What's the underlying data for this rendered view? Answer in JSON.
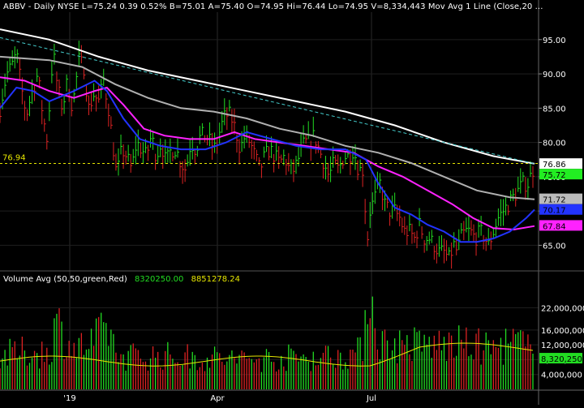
{
  "header": {
    "text": "ABBV - Daily  NYSE  L=75.24  0.39  0.52%  B=75.01  A=75.40  O=74.95  Hi=76.44  Lo=74.95  V=8,334,443  Mov Avg 1 Line (Close,20 ..."
  },
  "volume_header": {
    "label": "Volume Avg (50,50,green,Red)",
    "value1": "8320250.00",
    "value2": "8851278.24"
  },
  "colors": {
    "background": "#000000",
    "up_candle": "#22dd22",
    "down_candle": "#dd2222",
    "ma_white": "#ffffff",
    "ma_gray": "#b0b0b0",
    "ma_magenta": "#ff22ff",
    "ma_blue": "#2233ff",
    "trendline": "#44cccc",
    "ref_line": "#e6e600",
    "volume_avg": "#e6e600"
  },
  "chart_data": [
    {
      "type": "candlestick",
      "title": "ABBV - Daily NYSE",
      "x_labels": [
        "'19",
        "Apr",
        "Jul"
      ],
      "y_ticks": [
        "95.00",
        "90.00",
        "85.00",
        "80.00",
        "75.00",
        "70.00",
        "65.00"
      ],
      "ylim": [
        61.5,
        99
      ],
      "reference_line": {
        "value": 76.94,
        "label": "76.94"
      },
      "price_labels": [
        {
          "label": "76.86",
          "value": 76.86,
          "bg": "#ffffff",
          "fg": "#000000"
        },
        {
          "label": "75.72",
          "value": 75.72,
          "bg": "#22ee22",
          "fg": "#000000"
        },
        {
          "label": "71.72",
          "value": 71.72,
          "bg": "#bbbbbb",
          "fg": "#000000"
        },
        {
          "label": "70.17",
          "value": 70.17,
          "bg": "#2233ff",
          "fg": "#000000"
        },
        {
          "label": "67.84",
          "value": 67.84,
          "bg": "#ff22ff",
          "fg": "#000000"
        }
      ],
      "price_anchors": [
        [
          0,
          85
        ],
        [
          8,
          90
        ],
        [
          14,
          91
        ],
        [
          20,
          93
        ],
        [
          26,
          88
        ],
        [
          32,
          84
        ],
        [
          38,
          87
        ],
        [
          46,
          90
        ],
        [
          52,
          84
        ],
        [
          58,
          80
        ],
        [
          62,
          90
        ],
        [
          66,
          92
        ],
        [
          70,
          88
        ],
        [
          76,
          85
        ],
        [
          82,
          89
        ],
        [
          88,
          85
        ],
        [
          96,
          92
        ],
        [
          102,
          91
        ],
        [
          108,
          85
        ],
        [
          114,
          87
        ],
        [
          120,
          86
        ],
        [
          126,
          89
        ],
        [
          132,
          85
        ],
        [
          138,
          79
        ],
        [
          142,
          75
        ],
        [
          148,
          79
        ],
        [
          154,
          78
        ],
        [
          160,
          76
        ],
        [
          166,
          80
        ],
        [
          172,
          79
        ],
        [
          178,
          78
        ],
        [
          184,
          81
        ],
        [
          190,
          78
        ],
        [
          196,
          80
        ],
        [
          202,
          77
        ],
        [
          208,
          79
        ],
        [
          214,
          79
        ],
        [
          220,
          77
        ],
        [
          226,
          76
        ],
        [
          232,
          80
        ],
        [
          238,
          79
        ],
        [
          244,
          81
        ],
        [
          250,
          81
        ],
        [
          256,
          80
        ],
        [
          262,
          79
        ],
        [
          268,
          82
        ],
        [
          274,
          84
        ],
        [
          280,
          84
        ],
        [
          286,
          82
        ],
        [
          292,
          79
        ],
        [
          298,
          81
        ],
        [
          304,
          80
        ],
        [
          310,
          78
        ],
        [
          316,
          76
        ],
        [
          322,
          78
        ],
        [
          328,
          79
        ],
        [
          334,
          78
        ],
        [
          340,
          77
        ],
        [
          346,
          78
        ],
        [
          352,
          76
        ],
        [
          358,
          76
        ],
        [
          364,
          78
        ],
        [
          370,
          80
        ],
        [
          376,
          80
        ],
        [
          382,
          81
        ],
        [
          388,
          79
        ],
        [
          394,
          77
        ],
        [
          400,
          75
        ],
        [
          406,
          77
        ],
        [
          412,
          76
        ],
        [
          418,
          78
        ],
        [
          424,
          78
        ],
        [
          430,
          79
        ],
        [
          436,
          76
        ],
        [
          442,
          76
        ],
        [
          446,
          65
        ],
        [
          450,
          70
        ],
        [
          456,
          72
        ],
        [
          462,
          74
        ],
        [
          468,
          71
        ],
        [
          474,
          70
        ],
        [
          480,
          70
        ],
        [
          486,
          69
        ],
        [
          492,
          67
        ],
        [
          498,
          67
        ],
        [
          504,
          66
        ],
        [
          510,
          68
        ],
        [
          516,
          66
        ],
        [
          522,
          66
        ],
        [
          528,
          65
        ],
        [
          534,
          64
        ],
        [
          540,
          64
        ],
        [
          546,
          63
        ],
        [
          552,
          65
        ],
        [
          556,
          64
        ],
        [
          560,
          66
        ],
        [
          566,
          67
        ],
        [
          572,
          67
        ],
        [
          578,
          66
        ],
        [
          584,
          67
        ],
        [
          590,
          66
        ],
        [
          594,
          65
        ],
        [
          600,
          67
        ],
        [
          606,
          69
        ],
        [
          612,
          70
        ],
        [
          618,
          71
        ],
        [
          624,
          72
        ],
        [
          630,
          73
        ],
        [
          636,
          74
        ],
        [
          642,
          74
        ],
        [
          648,
          76
        ]
      ],
      "series": [
        {
          "name": "white MA",
          "color": "#ffffff",
          "points": [
            [
              0,
              96.5
            ],
            [
              60,
              95
            ],
            [
              120,
              92.5
            ],
            [
              180,
              90.5
            ],
            [
              240,
              89
            ],
            [
              300,
              87.5
            ],
            [
              360,
              86
            ],
            [
              420,
              84.5
            ],
            [
              480,
              82.5
            ],
            [
              540,
              80
            ],
            [
              600,
              78
            ],
            [
              650,
              76.9
            ]
          ]
        },
        {
          "name": "gray MA",
          "color": "#b0b0b0",
          "points": [
            [
              0,
              92.5
            ],
            [
              60,
              92
            ],
            [
              100,
              91
            ],
            [
              140,
              88.5
            ],
            [
              180,
              86.5
            ],
            [
              220,
              85
            ],
            [
              260,
              84.5
            ],
            [
              300,
              83.5
            ],
            [
              340,
              82
            ],
            [
              380,
              81
            ],
            [
              420,
              79.5
            ],
            [
              460,
              78.5
            ],
            [
              500,
              77
            ],
            [
              540,
              75
            ],
            [
              580,
              73
            ],
            [
              620,
              72
            ],
            [
              650,
              71.7
            ]
          ]
        },
        {
          "name": "magenta MA",
          "color": "#ff22ff",
          "points": [
            [
              0,
              89.5
            ],
            [
              30,
              89
            ],
            [
              60,
              87.5
            ],
            [
              90,
              86.5
            ],
            [
              115,
              87.5
            ],
            [
              130,
              88
            ],
            [
              150,
              85.5
            ],
            [
              175,
              82
            ],
            [
              200,
              81
            ],
            [
              230,
              80.5
            ],
            [
              260,
              80.5
            ],
            [
              285,
              81.5
            ],
            [
              310,
              80.5
            ],
            [
              340,
              80
            ],
            [
              370,
              79.5
            ],
            [
              400,
              79
            ],
            [
              430,
              78.5
            ],
            [
              460,
              76.5
            ],
            [
              490,
              75
            ],
            [
              520,
              73
            ],
            [
              550,
              71
            ],
            [
              575,
              69
            ],
            [
              600,
              67.5
            ],
            [
              625,
              67.3
            ],
            [
              650,
              67.8
            ]
          ]
        },
        {
          "name": "blue MA",
          "color": "#2233ff",
          "points": [
            [
              0,
              85
            ],
            [
              20,
              88
            ],
            [
              40,
              87.5
            ],
            [
              60,
              86
            ],
            [
              90,
              87.5
            ],
            [
              115,
              89
            ],
            [
              130,
              87.5
            ],
            [
              150,
              83.5
            ],
            [
              170,
              80.5
            ],
            [
              195,
              79.5
            ],
            [
              220,
              79
            ],
            [
              250,
              79
            ],
            [
              275,
              80
            ],
            [
              300,
              81.5
            ],
            [
              330,
              80.5
            ],
            [
              360,
              79.5
            ],
            [
              390,
              79
            ],
            [
              420,
              79
            ],
            [
              445,
              77.5
            ],
            [
              460,
              74
            ],
            [
              480,
              70.5
            ],
            [
              500,
              69.5
            ],
            [
              520,
              68
            ],
            [
              540,
              67
            ],
            [
              560,
              65.5
            ],
            [
              580,
              65.5
            ],
            [
              600,
              66
            ],
            [
              620,
              67
            ],
            [
              640,
              69
            ],
            [
              650,
              70.2
            ]
          ]
        },
        {
          "name": "trend line",
          "color": "#44cccc",
          "dashed": true,
          "points": [
            [
              0,
              95.3
            ],
            [
              650,
              76.9
            ]
          ]
        }
      ]
    },
    {
      "type": "bar",
      "title": "Volume Avg (50,50,green,Red)",
      "y_ticks": [
        "22,000,000",
        "16,000,000",
        "12,000,000",
        "8,000,000",
        "4,000,000"
      ],
      "ylim": [
        0,
        28000000
      ],
      "last_value_label": "8,320,250",
      "volume_avg_level": 8300000,
      "volume_anchors": [
        [
          0,
          9
        ],
        [
          30,
          10
        ],
        [
          60,
          10
        ],
        [
          68,
          18
        ],
        [
          90,
          11
        ],
        [
          110,
          12
        ],
        [
          135,
          17
        ],
        [
          140,
          9
        ],
        [
          200,
          9
        ],
        [
          300,
          8
        ],
        [
          400,
          9
        ],
        [
          440,
          10
        ],
        [
          446,
          27
        ],
        [
          452,
          24
        ],
        [
          460,
          14
        ],
        [
          470,
          12
        ],
        [
          500,
          12
        ],
        [
          560,
          12
        ],
        [
          600,
          11
        ],
        [
          630,
          13
        ],
        [
          650,
          9
        ]
      ]
    }
  ]
}
